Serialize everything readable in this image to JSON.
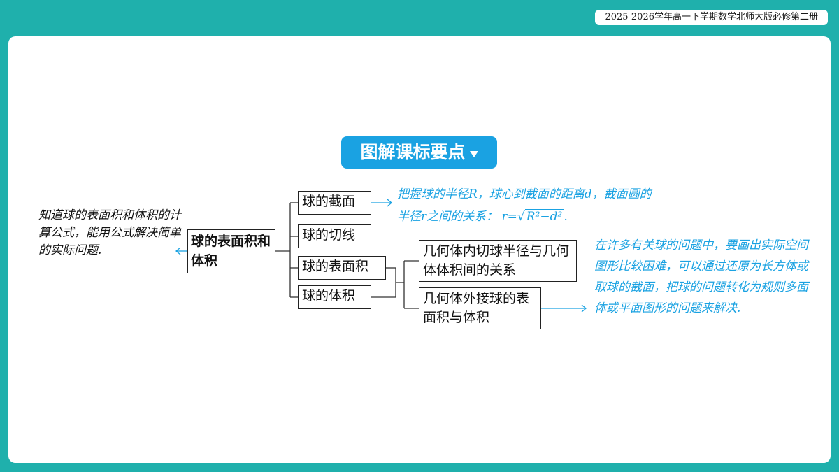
{
  "header": {
    "badge": "2025-2026学年高一下学期数学北师大版必修第二册"
  },
  "title": {
    "label": "图解课标要点"
  },
  "left_text": "知道球的表面积和体积的计算公式，能用公式解决简单的实际问题.",
  "main_node": "球的表面积和体积",
  "branches": [
    "球的截面",
    "球的切线",
    "球的表面积",
    "球的体积"
  ],
  "sub_branches": [
    "几何体内切球半径与几何体体积间的关系",
    "几何体外接球的表面积与体积"
  ],
  "note_section": {
    "line1": "把握球的半径R，球心到截面的距离d，截面圆的",
    "line2_prefix": "半径r之间的关系：",
    "formula_lhs": "r=",
    "formula_radicand": "R²−d²",
    "formula_end": "."
  },
  "note_circumscribed": "在许多有关球的问题中，要画出实际空间图形比较困难，可以通过还原为长方体或取球的截面，把球的问题转化为规则多面体或平面图形的问题来解决.",
  "colors": {
    "frame": "#1fb0ac",
    "accent": "#1aa2e2"
  }
}
